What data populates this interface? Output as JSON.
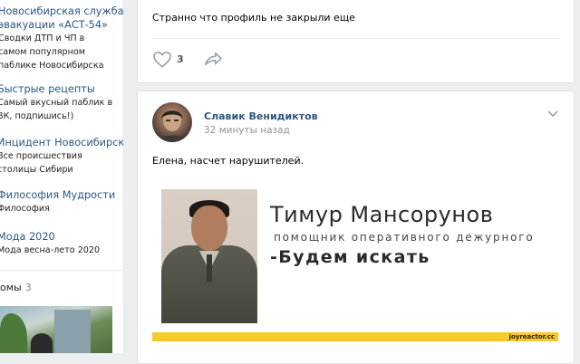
{
  "groups": [
    {
      "title_lines": [
        "Новосибирская служба",
        "эвакуации «АСТ-54»"
      ],
      "desc_lines": [
        "Сводки ДТП и ЧП в",
        "самом популярном",
        "паблике Новосибирска"
      ]
    },
    {
      "title_lines": [
        "Быстрые рецепты"
      ],
      "desc_lines": [
        "Самый вкусный паблик в",
        "ВК, подпишись!)"
      ]
    },
    {
      "title_lines": [
        "Инцидент Новосибирск"
      ],
      "desc_lines": [
        "Все происшествия",
        "столицы Сибири"
      ]
    },
    {
      "title_lines": [
        "Философия Мудрости"
      ],
      "desc_lines": [
        "Философия"
      ]
    },
    {
      "title_lines": [
        "Мода 2020"
      ],
      "desc_lines": [
        "Мода весна-лето 2020"
      ]
    }
  ],
  "friends": {
    "label": "омы",
    "count": "3"
  },
  "post1": {
    "text": "Странно что профиль не закрыли еще",
    "likes": "3"
  },
  "post2": {
    "author": "Славик Венидиктов",
    "time": "32 минуты назад",
    "text": "Елена, насчет нарушителей.",
    "image": {
      "name": "Тимур Мансорунов",
      "role": "помощник оперативного дежурного",
      "quote": "-Будем искать",
      "watermark": "joyreactor.cc"
    }
  },
  "colors": {
    "link": "#2a5885",
    "background": "#edeef0",
    "watermark_bar": "#f8c928"
  },
  "icons": {
    "like": "heart-icon",
    "share": "share-arrow-icon",
    "menu": "chevron-down-icon"
  }
}
